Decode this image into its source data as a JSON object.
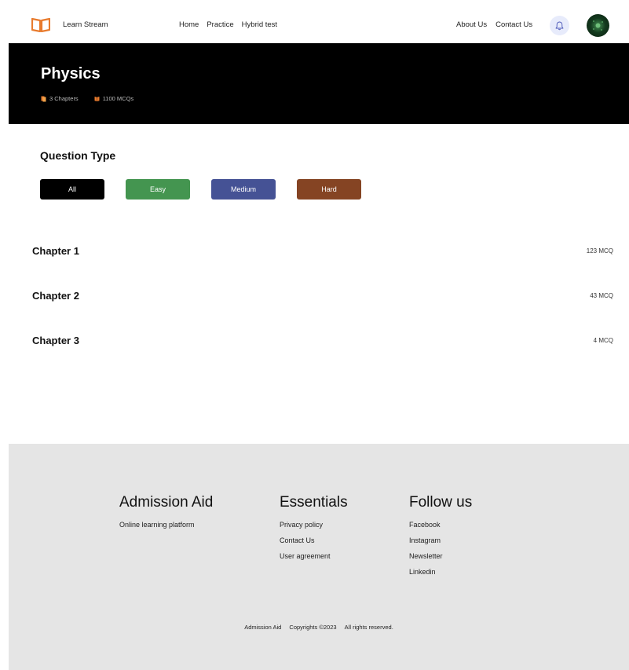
{
  "nav": {
    "brand": "Learn Stream",
    "links": [
      "Home",
      "Practice",
      "Hybrid test"
    ],
    "right_links": [
      "About Us",
      "Contact Us"
    ],
    "logo_icon": "open-book-logo-icon",
    "bell_icon": "bell-icon",
    "accent": "#e87b2e"
  },
  "banner": {
    "title": "Physics",
    "chapters": "3 Chapters",
    "mcqs": "1100 MCQs"
  },
  "question_type": {
    "title": "Question Type",
    "filters": [
      {
        "label": "All",
        "color": "#000000"
      },
      {
        "label": "Easy",
        "color": "#449550"
      },
      {
        "label": "Medium",
        "color": "#455295"
      },
      {
        "label": "Hard",
        "color": "#854423"
      }
    ]
  },
  "chapters": [
    {
      "name": "Chapter 1",
      "count": "123 MCQ"
    },
    {
      "name": "Chapter 2",
      "count": "43 MCQ"
    },
    {
      "name": "Chapter 3",
      "count": "4 MCQ"
    }
  ],
  "footer": {
    "col1": {
      "title": "Admission Aid",
      "tagline": "Online learning platform"
    },
    "col2": {
      "title": "Essentials",
      "links": [
        "Privacy policy",
        "Contact Us",
        "User agreement"
      ]
    },
    "col3": {
      "title": "Follow us",
      "links": [
        "Facebook",
        "Instagram",
        "Newsletter",
        "Linkedin"
      ]
    },
    "copyright": {
      "brand": "Admission Aid",
      "year": "Copyrights ©2023",
      "rights": "All rights reserved."
    }
  }
}
